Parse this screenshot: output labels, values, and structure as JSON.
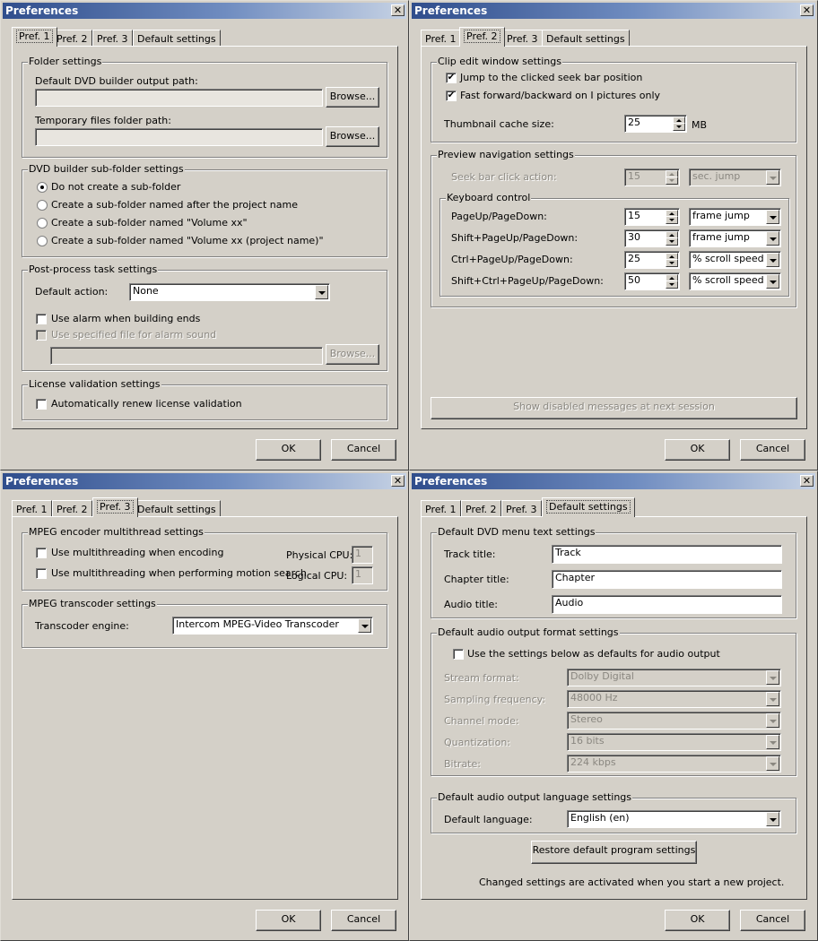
{
  "window_title": "Preferences",
  "tabs": [
    "Pref. 1",
    "Pref. 2",
    "Pref. 3",
    "Default settings"
  ],
  "buttons": {
    "ok": "OK",
    "cancel": "Cancel",
    "browse": "Browse..."
  },
  "pref1": {
    "folder_group": "Folder settings",
    "dvd_output_label": "Default DVD builder output path:",
    "dvd_output_value": "",
    "temp_folder_label": "Temporary files folder path:",
    "temp_folder_value": "",
    "subfolder_group": "DVD builder sub-folder settings",
    "radio_options": [
      "Do not create a sub-folder",
      "Create a sub-folder named after the project name",
      "Create a sub-folder named \"Volume xx\"",
      "Create a sub-folder named \"Volume xx (project name)\""
    ],
    "radio_selected": 0,
    "postprocess_group": "Post-process task settings",
    "default_action_label": "Default action:",
    "default_action_value": "None",
    "use_alarm_label": "Use alarm when building ends",
    "use_file_label": "Use specified file for alarm sound",
    "alarm_file_value": "",
    "license_group": "License validation settings",
    "auto_renew_label": "Automatically renew license validation"
  },
  "pref2": {
    "clip_group": "Clip edit window settings",
    "jump_label": "Jump to the clicked seek bar position",
    "jump_checked": true,
    "ff_label": "Fast forward/backward on I pictures only",
    "ff_checked": true,
    "thumb_label": "Thumbnail cache size:",
    "thumb_value": "25",
    "thumb_unit": "MB",
    "preview_group": "Preview navigation settings",
    "seekbar_label": "Seek bar click action:",
    "seekbar_value": "15",
    "seekbar_mode": "sec. jump",
    "keyboard_group": "Keyboard control",
    "keys": [
      {
        "label": "PageUp/PageDown:",
        "value": "15",
        "mode": "frame jump"
      },
      {
        "label": "Shift+PageUp/PageDown:",
        "value": "30",
        "mode": "frame jump"
      },
      {
        "label": "Ctrl+PageUp/PageDown:",
        "value": "25",
        "mode": "% scroll speed"
      },
      {
        "label": "Shift+Ctrl+PageUp/PageDown:",
        "value": "50",
        "mode": "% scroll speed"
      }
    ],
    "show_disabled_label": "Show disabled messages at next session"
  },
  "pref3": {
    "mpeg_group": "MPEG encoder multithread settings",
    "mt_encoding_label": "Use multithreading when encoding",
    "mt_motion_label": "Use multithreading when performing motion search",
    "physical_cpu_label": "Physical CPU:",
    "physical_cpu_value": "1",
    "logical_cpu_label": "Logical CPU:",
    "logical_cpu_value": "1",
    "transcoder_group": "MPEG transcoder settings",
    "engine_label": "Transcoder engine:",
    "engine_value": "Intercom MPEG-Video Transcoder"
  },
  "defaults": {
    "menu_group": "Default DVD menu text settings",
    "track_label": "Track title:",
    "track_value": "Track",
    "chapter_label": "Chapter title:",
    "chapter_value": "Chapter",
    "audio_label": "Audio title:",
    "audio_value": "Audio",
    "audio_format_group": "Default audio output format settings",
    "use_settings_label": "Use the settings below as defaults for audio output",
    "stream_label": "Stream format:",
    "stream_value": "Dolby Digital",
    "sampling_label": "Sampling frequency:",
    "sampling_value": "48000 Hz",
    "channel_label": "Channel mode:",
    "channel_value": "Stereo",
    "quant_label": "Quantization:",
    "quant_value": "16 bits",
    "bitrate_label": "Bitrate:",
    "bitrate_value": "224 kbps",
    "language_group": "Default audio output language settings",
    "language_label": "Default language:",
    "language_value": "English (en)",
    "restore_label": "Restore default program settings",
    "note": "Changed settings are activated when you start a new project."
  }
}
